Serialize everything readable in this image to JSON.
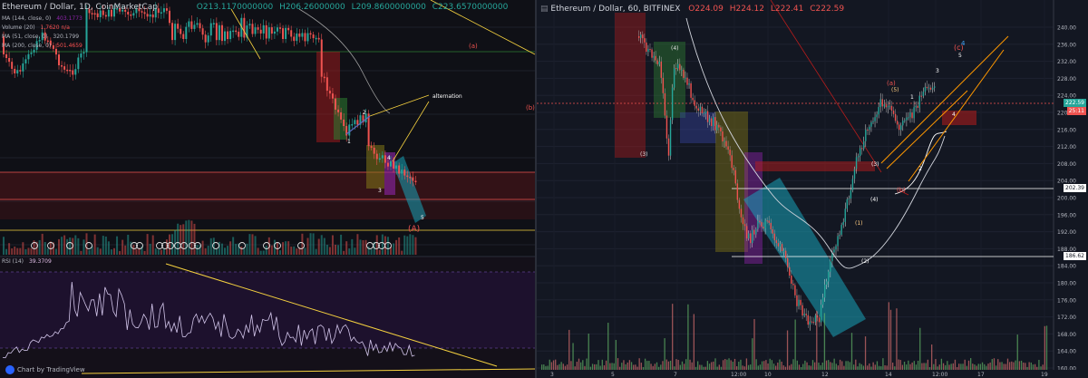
{
  "left": {
    "symbol": "Ethereum / Dollar, 1D, CoinMarketCap",
    "ohlc": {
      "o": "O213.1170000000",
      "h": "H206.26000000",
      "l": "L209.8600000000",
      "c": "C223.6570000000"
    },
    "indicators": [
      {
        "name": "MA (144, close, 0)",
        "value": "403.1773",
        "color": "#b2b5be"
      },
      {
        "name": "Volume (20)",
        "value": "1.7620 n/a",
        "color": "#b2b5be"
      },
      {
        "name": "MA (51, close, 0)",
        "value": "320.1799",
        "color": "#b2b5be"
      },
      {
        "name": "MA (200, close, 0)",
        "value": "501.4659",
        "color": "#ff5252"
      }
    ],
    "annotations": {
      "a": "(a)",
      "b": "(b)",
      "alternation": "alternation",
      "A": "(A)",
      "w2": "2",
      "w4": "4",
      "w1": "1",
      "w3": "3",
      "w5": "5"
    },
    "rsi": {
      "label": "RSI (14)",
      "value": "39.3709"
    },
    "watermark": "Chart by TradingView"
  },
  "right": {
    "symbol": "Ethereum / Dollar, 60, BITFINEX",
    "ohlc": {
      "o": "O224.09",
      "h": "H224.12",
      "l": "L222.41",
      "c": "C222.59"
    },
    "annotations": {
      "c": "(c)",
      "a": "(a)",
      "b": "(b)",
      "v": "(5)",
      "iii": "(3)",
      "iv": "(4)",
      "i": "(1)",
      "ii": "(2)",
      "big3": "(3)",
      "big4": "(4)",
      "w1": "1",
      "w2": "2",
      "w3": "3",
      "w4": "4",
      "w5": "5",
      "circ4": "4"
    },
    "badges": {
      "last_price": "222.59",
      "time_left": "25:11",
      "level1": "202.39",
      "level2": "186.62"
    },
    "price_axis": [
      "240.00",
      "236.00",
      "232.00",
      "228.00",
      "224.00",
      "220.00",
      "216.00",
      "212.00",
      "208.00",
      "204.00",
      "200.00",
      "196.00",
      "192.00",
      "188.00",
      "184.00",
      "180.00",
      "176.00",
      "172.00",
      "168.00",
      "164.00",
      "160.00"
    ],
    "time_axis": [
      "3",
      "5",
      "7",
      "12:00",
      "10",
      "12",
      "14",
      "12:00",
      "17",
      "19"
    ]
  },
  "chart_data": [
    {
      "type": "candlestick",
      "title": "Ethereum / Dollar, 1D, CoinMarketCap",
      "note": "daily chart with Elliott wave labels and RSI (14) sub-panel",
      "rsi_value": 39.3709,
      "indicators": {
        "MA144": 403.1773,
        "MA51": 320.1799,
        "MA200": 501.4659
      }
    },
    {
      "type": "candlestick",
      "title": "Ethereum / Dollar, 60, BITFINEX",
      "ohlc": {
        "open": 224.09,
        "high": 224.12,
        "low": 222.41,
        "close": 222.59
      },
      "ylim": [
        160,
        242
      ],
      "horizontal_levels": [
        202.39,
        186.62
      ],
      "last_price": 222.59
    }
  ],
  "colors": {
    "up": "#26a69a",
    "down": "#ef5350",
    "trend": "#f4d03f",
    "orange": "#ff9800",
    "teal_box": "#17a2b8",
    "red_box": "#b71c1c",
    "green_box": "#2e7d32",
    "purple_box": "#8e24aa",
    "olive_box": "#827717",
    "blue_box": "#3949ab"
  }
}
